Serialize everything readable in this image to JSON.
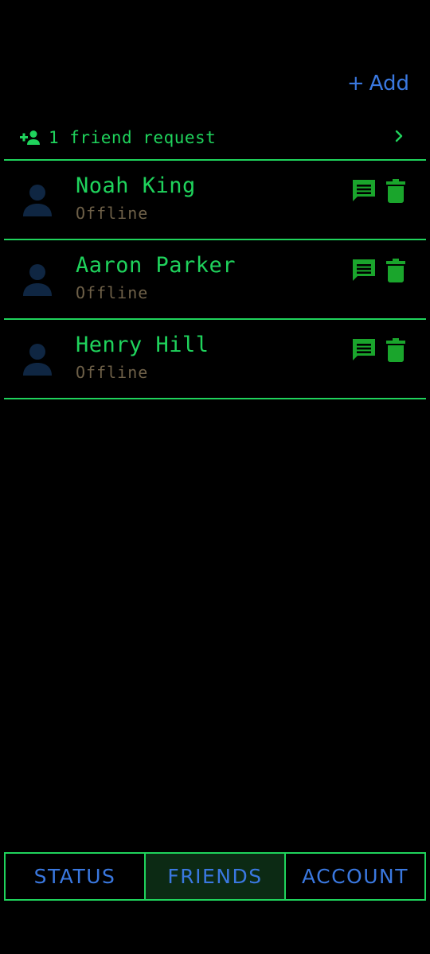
{
  "header": {
    "add_label": "Add",
    "add_icon": "plus-icon"
  },
  "friend_request": {
    "label": "1 friend request",
    "icon": "person-add-icon",
    "chevron": "chevron-right-icon"
  },
  "friends": [
    {
      "name": "Noah King",
      "status": "Offline"
    },
    {
      "name": "Aaron Parker",
      "status": "Offline"
    },
    {
      "name": "Henry Hill",
      "status": "Offline"
    }
  ],
  "bottom_nav": {
    "tabs": [
      {
        "label": "STATUS",
        "active": false
      },
      {
        "label": "FRIENDS",
        "active": true
      },
      {
        "label": "ACCOUNT",
        "active": false
      }
    ]
  },
  "colors": {
    "accent_green": "#1fd35c",
    "icon_green": "#1aa52c",
    "link_blue": "#3a78e0",
    "status_brown": "#6e6048",
    "avatar_navy": "#0f2642",
    "active_tab_bg": "#0c2a14",
    "background": "#000000"
  }
}
